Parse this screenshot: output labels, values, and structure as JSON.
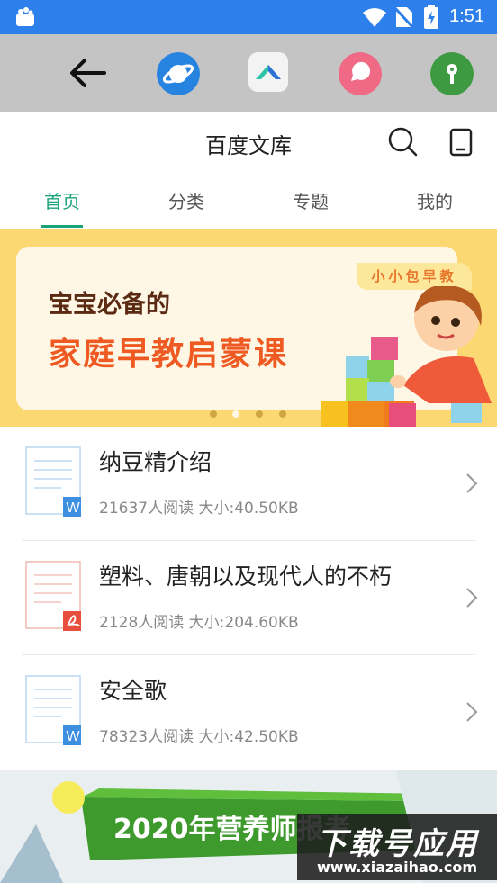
{
  "status_bar": {
    "time": "1:51"
  },
  "header": {
    "title": "百度文库"
  },
  "tabs": [
    {
      "label": "首页",
      "active": true
    },
    {
      "label": "分类",
      "active": false
    },
    {
      "label": "专题",
      "active": false
    },
    {
      "label": "我的",
      "active": false
    }
  ],
  "banner": {
    "badge": "小小包早教",
    "line1": "宝宝必备的",
    "line2": "家庭早教启蒙课",
    "dots_total": 4,
    "active_dot": 1
  },
  "documents": [
    {
      "title": "纳豆精介绍",
      "meta": "21637人阅读 大小:40.50KB",
      "type": "W",
      "type_color": "#3d8fe0",
      "icon": "word-doc-icon"
    },
    {
      "title": "塑料、唐朝以及现代人的不朽",
      "meta": "2128人阅读 大小:204.60KB",
      "type": "pdf",
      "type_color": "#e84e3c",
      "icon": "pdf-doc-icon"
    },
    {
      "title": "安全歌",
      "meta": "78323人阅读 大小:42.50KB",
      "type": "W",
      "type_color": "#3d8fe0",
      "icon": "word-doc-icon"
    }
  ],
  "ad": {
    "text": "2020年营养师报考"
  },
  "watermark": {
    "main": "下载号应用",
    "sub": "www.xiazaihao.com"
  },
  "colors": {
    "accent": "#1aa37a",
    "status_bar": "#2d80ec",
    "banner_bg": "#fcd873"
  }
}
